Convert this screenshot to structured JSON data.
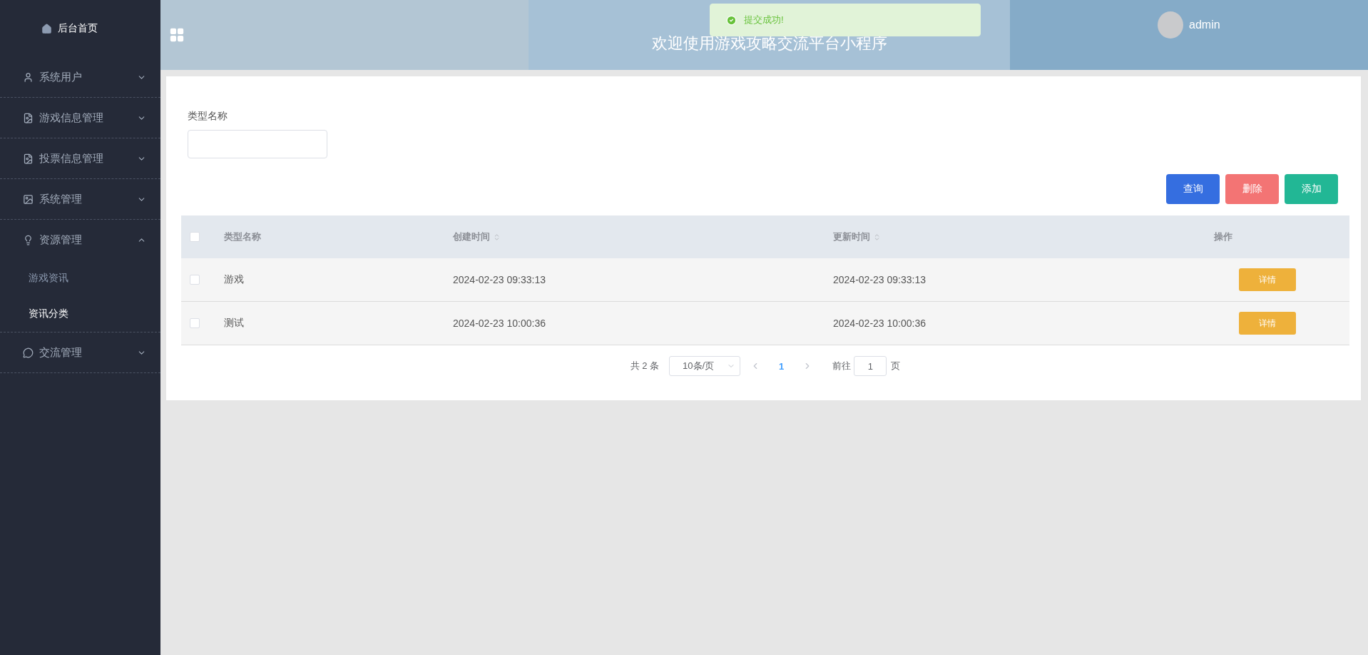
{
  "sidebar": {
    "home": {
      "label": "后台首页"
    },
    "items": [
      {
        "label": "系统用户",
        "expanded": false
      },
      {
        "label": "游戏信息管理",
        "expanded": false
      },
      {
        "label": "投票信息管理",
        "expanded": false
      },
      {
        "label": "系统管理",
        "expanded": false
      },
      {
        "label": "资源管理",
        "expanded": true,
        "children": [
          {
            "label": "游戏资讯",
            "selected": false
          },
          {
            "label": "资讯分类",
            "selected": true
          }
        ]
      },
      {
        "label": "交流管理",
        "expanded": false
      }
    ]
  },
  "header": {
    "title": "欢迎使用游戏攻略交流平台小程序",
    "user": "admin"
  },
  "toast": {
    "message": "提交成功!"
  },
  "search": {
    "label": "类型名称"
  },
  "buttons": [
    {
      "label": "查询",
      "kind": "primary"
    },
    {
      "label": "删除",
      "kind": "danger"
    },
    {
      "label": "添加",
      "kind": "success"
    }
  ],
  "table": {
    "columns": [
      {
        "label": "类型名称",
        "sortable": false
      },
      {
        "label": "创建时间",
        "sortable": true
      },
      {
        "label": "更新时间",
        "sortable": true
      },
      {
        "label": "操作",
        "sortable": false
      }
    ],
    "all_checked": false,
    "rows": [
      {
        "checked": false,
        "cells": [
          "游戏",
          "2024-02-23 09:33:13",
          "2024-02-23 09:33:13"
        ],
        "action": "详情"
      },
      {
        "checked": false,
        "cells": [
          "测试",
          "2024-02-23 10:00:36",
          "2024-02-23 10:00:36"
        ],
        "action": "详情"
      }
    ]
  },
  "pagination": {
    "total": "共 2 条",
    "page_size": "10条/页",
    "pages": [
      {
        "label": "1",
        "selected": true
      }
    ],
    "goto_label": "前往",
    "goto_value": "1",
    "page_suffix": "页"
  }
}
